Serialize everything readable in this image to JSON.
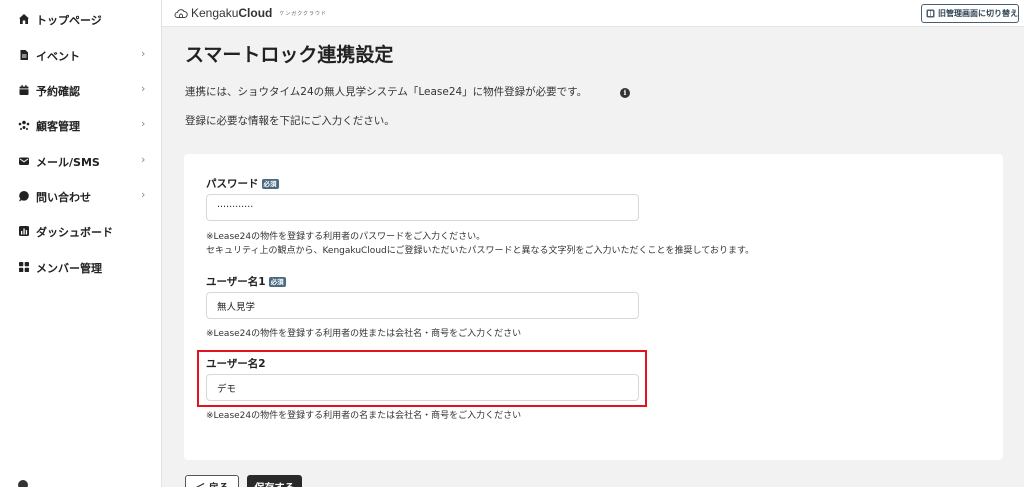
{
  "logo": {
    "word_regular": "Kengaku",
    "word_bold": "Cloud",
    "sub": "ケンガククラウド"
  },
  "sidebar": {
    "items": [
      {
        "label": "トップページ",
        "icon": "home-icon"
      },
      {
        "label": "イベント",
        "icon": "document-icon"
      },
      {
        "label": "予約確認",
        "icon": "calendar-icon"
      },
      {
        "label": "顧客管理",
        "icon": "users-icon"
      },
      {
        "label": "メール/SMS",
        "icon": "mail-icon"
      },
      {
        "label": "問い合わせ",
        "icon": "chat-bubble-icon"
      },
      {
        "label": "ダッシュボード",
        "icon": "bar-chart-icon"
      },
      {
        "label": "メンバー管理",
        "icon": "grid-icon"
      }
    ]
  },
  "header": {
    "legacy_button": "旧管理画面に切り替え"
  },
  "main": {
    "title": "スマートロック連携設定",
    "intro_line1": "連携には、ショウタイム24の無人見学システム「Lease24」に物件登録が必要です。",
    "intro_line2": "登録に必要な情報を下記にご入力ください。"
  },
  "form": {
    "required_badge": "必須",
    "password": {
      "label": "パスワード",
      "value": "············",
      "help1": "※Lease24の物件を登録する利用者のパスワードをご入力ください。",
      "help2": "セキュリティ上の観点から、KengakuCloudにご登録いただいたパスワードと異なる文字列をご入力いただくことを推奨しております。"
    },
    "username1": {
      "label": "ユーザー名1",
      "value": "無人見学",
      "help": "※Lease24の物件を登録する利用者の姓または会社名・商号をご入力ください"
    },
    "username2": {
      "label": "ユーザー名2",
      "value": "デモ",
      "help": "※Lease24の物件を登録する利用者の名または会社名・商号をご入力ください"
    }
  },
  "footer": {
    "back_label": "＜ 戻る",
    "save_label": "保存する"
  },
  "colors": {
    "accent": "#4a6a80",
    "highlight": "#e0141e",
    "primary_button": "#2a2a2a"
  }
}
